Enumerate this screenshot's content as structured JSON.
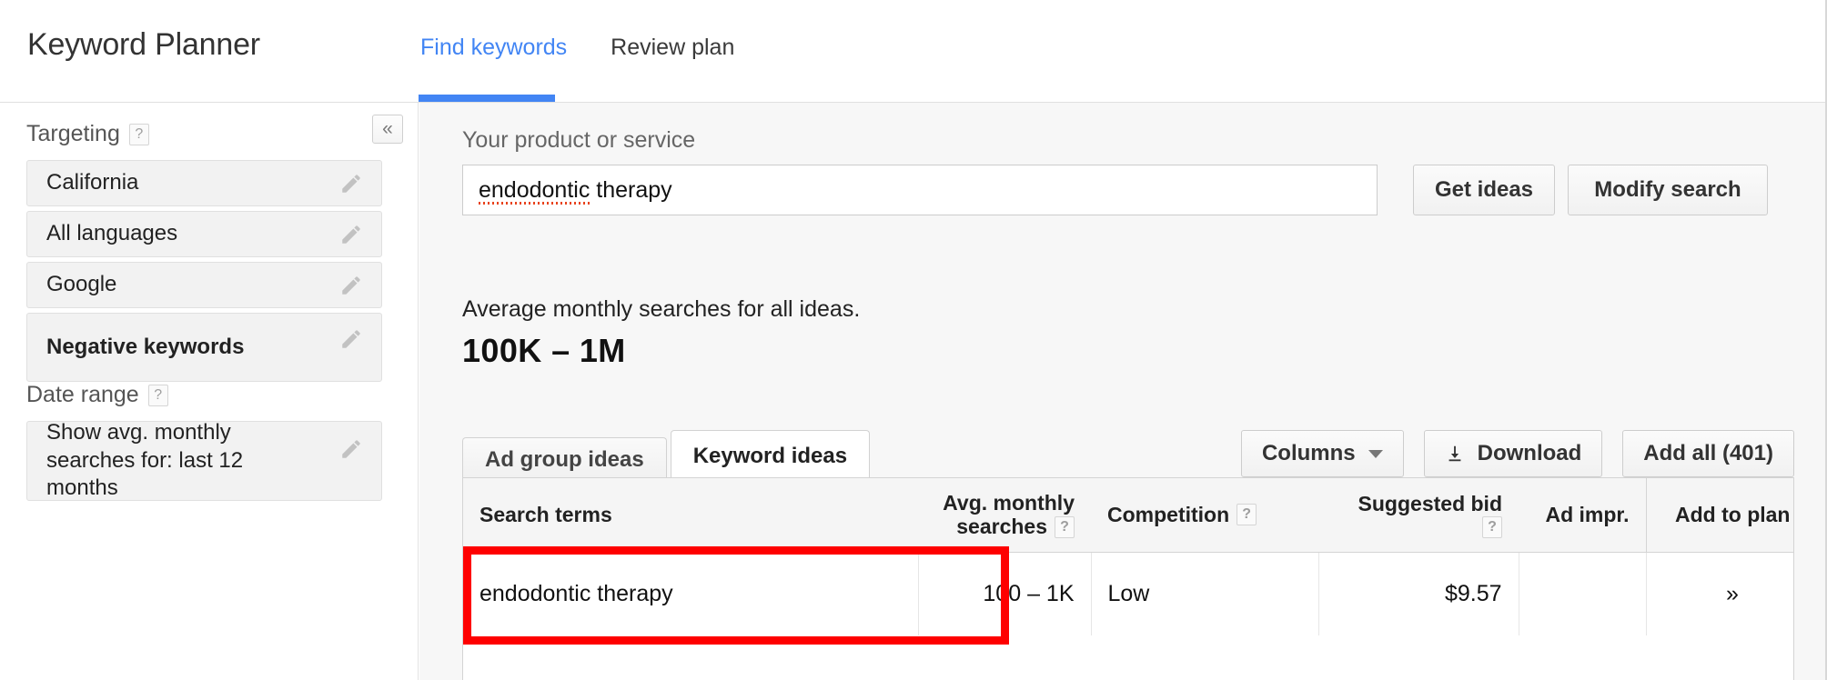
{
  "header": {
    "title": "Keyword Planner",
    "tabs": [
      {
        "label": "Find keywords",
        "active": true
      },
      {
        "label": "Review plan",
        "active": false
      }
    ]
  },
  "sidebar": {
    "collapse_icon": "double-chevron-left-icon",
    "targeting": {
      "label": "Targeting",
      "help": "?",
      "items": [
        {
          "label": "California",
          "bold": false,
          "edit_icon": "pencil-icon"
        },
        {
          "label": "All languages",
          "bold": false,
          "edit_icon": "pencil-icon"
        },
        {
          "label": "Google",
          "bold": false,
          "edit_icon": "pencil-icon"
        },
        {
          "label": "Negative keywords",
          "bold": true,
          "edit_icon": "pencil-icon"
        }
      ]
    },
    "date_range": {
      "label": "Date range",
      "help": "?",
      "value": "Show avg. monthly searches for: last 12 months",
      "edit_icon": "pencil-icon"
    }
  },
  "main": {
    "search": {
      "field_label": "Your product or service",
      "value": "endodontic therapy",
      "value_misspelled": "endodontic",
      "value_rest": " therapy",
      "placeholder": "Your product or service",
      "get_ideas_label": "Get ideas",
      "modify_label": "Modify search"
    },
    "summary": {
      "caption": "Average monthly searches for all ideas.",
      "value": "100K – 1M"
    },
    "idea_tabs": [
      {
        "label": "Ad group ideas",
        "active": false
      },
      {
        "label": "Keyword ideas",
        "active": true
      }
    ],
    "toolbar": {
      "columns_label": "Columns",
      "columns_icon": "chevron-down-icon",
      "download_label": "Download",
      "download_icon": "download-icon",
      "add_all_label": "Add all (401)"
    },
    "table": {
      "columns": [
        {
          "key": "term",
          "label": "Search terms",
          "help": null
        },
        {
          "key": "avg",
          "label_line1": "Avg. monthly",
          "label_line2": "searches",
          "help": "?"
        },
        {
          "key": "comp",
          "label": "Competition",
          "help": "?"
        },
        {
          "key": "bid",
          "label": "Suggested bid",
          "help": "?"
        },
        {
          "key": "impr",
          "label": "Ad impr.",
          "help": null
        },
        {
          "key": "add",
          "label": "Add to plan",
          "help": null
        }
      ],
      "rows": [
        {
          "term": "endodontic therapy",
          "avg": "100 – 1K",
          "comp": "Low",
          "bid": "$9.57",
          "impr": "",
          "add": "»",
          "highlighted": true
        }
      ]
    }
  },
  "colors": {
    "accent_blue": "#4285f4",
    "highlight_red": "#fe0000",
    "panel_gray": "#f7f7f7",
    "chip_gray": "#f2f2f2"
  }
}
